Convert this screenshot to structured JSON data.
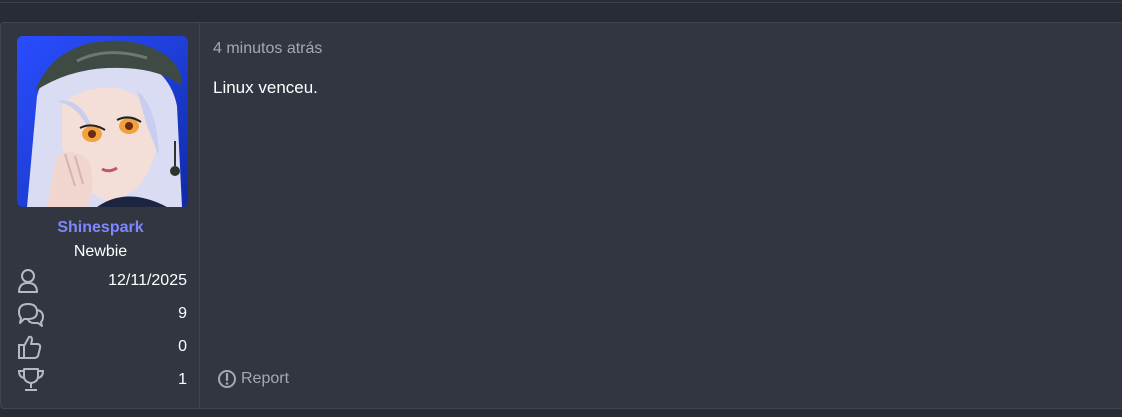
{
  "post": {
    "timestamp": "4 minutos atrás",
    "message": "Linux venceu.",
    "report_label": "Report"
  },
  "user": {
    "name": "Shinespark",
    "title": "Newbie",
    "stats": {
      "joined": "12/11/2025",
      "messages": "9",
      "reactions": "0",
      "points": "1"
    }
  },
  "colors": {
    "username": "#7f87ff",
    "post_bg": "#323641",
    "page_bg": "#282c35",
    "muted_text": "#a4a8b1"
  },
  "icons": {
    "joined": "user-icon",
    "messages": "chat-bubbles-icon",
    "reactions": "thumbs-up-icon",
    "points": "trophy-icon",
    "report": "exclamation-circle-icon"
  }
}
